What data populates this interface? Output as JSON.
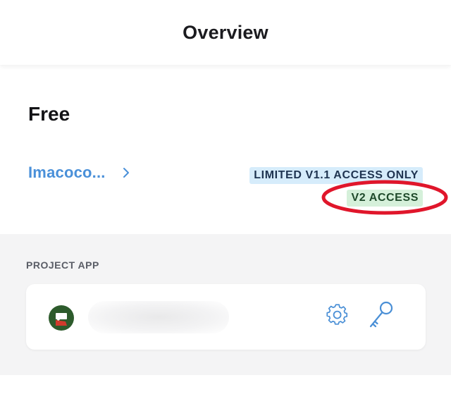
{
  "header": {
    "title": "Overview"
  },
  "plan": {
    "title": "Free",
    "account_name": "Imacoco...",
    "badges": {
      "limited": "LIMITED V1.1 ACCESS ONLY",
      "v2": "V2 ACCESS"
    },
    "highlight_color": "#e0162b"
  },
  "project_app": {
    "section_label": "PROJECT APP",
    "avatar_color": "#2d5b2c",
    "icons": [
      "gear-icon",
      "key-icon"
    ],
    "icon_color": "#4a8fd6"
  }
}
